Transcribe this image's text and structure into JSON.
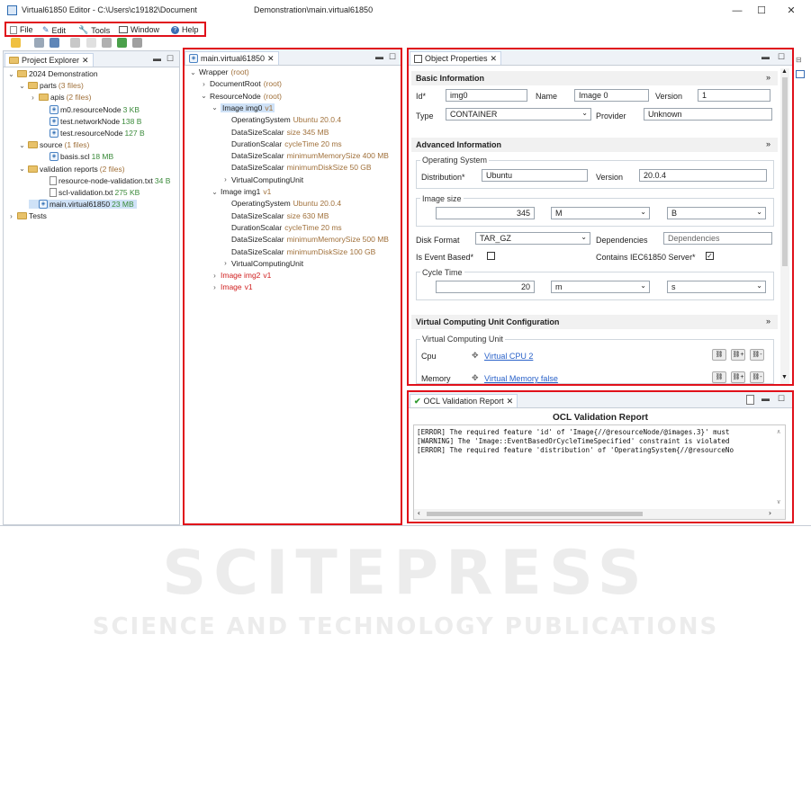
{
  "window": {
    "title": "Virtual61850 Editor - C:\\Users\\c19182\\Document",
    "title_suffix": "Demonstration\\main.virtual61850",
    "controls": [
      "—",
      "☐",
      "✕"
    ]
  },
  "menu": [
    "File",
    "Edit",
    "Tools",
    "Window",
    "Help"
  ],
  "project_explorer": {
    "tab_label": "Project Explorer",
    "items": [
      {
        "label": "2024 Demonstration",
        "extra": "",
        "depth": 0,
        "arrow": "⌄",
        "icon": "project"
      },
      {
        "label": "parts",
        "extra": "(3 files)",
        "depth": 1,
        "arrow": "⌄",
        "icon": "folder"
      },
      {
        "label": "apis",
        "extra": "(2 files)",
        "depth": 2,
        "arrow": "›",
        "icon": "folder"
      },
      {
        "label": "m0.resourceNode",
        "extra": "3 KB",
        "depth": 3,
        "arrow": "",
        "icon": "file"
      },
      {
        "label": "test.networkNode",
        "extra": "138 B",
        "depth": 3,
        "arrow": "",
        "icon": "file"
      },
      {
        "label": "test.resourceNode",
        "extra": "127 B",
        "depth": 3,
        "arrow": "",
        "icon": "file"
      },
      {
        "label": "source",
        "extra": "(1 files)",
        "depth": 1,
        "arrow": "⌄",
        "icon": "folder"
      },
      {
        "label": "basis.scl",
        "extra": "18 MB",
        "depth": 3,
        "arrow": "",
        "icon": "file"
      },
      {
        "label": "validation reports",
        "extra": "(2 files)",
        "depth": 1,
        "arrow": "⌄",
        "icon": "folder"
      },
      {
        "label": "resource-node-validation.txt",
        "extra": "34 B",
        "depth": 3,
        "arrow": "",
        "icon": "txt"
      },
      {
        "label": "scl-validation.txt",
        "extra": "275 KB",
        "depth": 3,
        "arrow": "",
        "icon": "txt"
      },
      {
        "label": "main.virtual61850",
        "extra": "23 MB",
        "depth": 2,
        "arrow": "",
        "icon": "file",
        "selected": true
      },
      {
        "label": "Tests",
        "extra": "",
        "depth": 0,
        "arrow": "›",
        "icon": "project"
      }
    ]
  },
  "editor": {
    "tab_label": "main.virtual61850",
    "rows": [
      {
        "label": "Wrapper",
        "extra": "(root)",
        "depth": 0,
        "arrow": "⌄",
        "color": "normal"
      },
      {
        "label": "DocumentRoot",
        "extra": "(root)",
        "depth": 1,
        "arrow": "›",
        "color": "normal"
      },
      {
        "label": "ResourceNode",
        "extra": "(root)",
        "depth": 1,
        "arrow": "⌄",
        "color": "normal"
      },
      {
        "label": "Image img0",
        "extra": "v1",
        "depth": 2,
        "arrow": "⌄",
        "color": "normal",
        "selected": true
      },
      {
        "label": "OperatingSystem",
        "extra": "Ubuntu 20.0.4",
        "depth": 3,
        "arrow": "",
        "color": "normal"
      },
      {
        "label": "DataSizeScalar",
        "extra": "size 345 MB",
        "depth": 3,
        "arrow": "",
        "color": "normal"
      },
      {
        "label": "DurationScalar",
        "extra": "cycleTime 20 ms",
        "depth": 3,
        "arrow": "",
        "color": "normal"
      },
      {
        "label": "DataSizeScalar",
        "extra": "minimumMemorySize 400 MB",
        "depth": 3,
        "arrow": "",
        "color": "normal"
      },
      {
        "label": "DataSizeScalar",
        "extra": "minimumDiskSize 50 GB",
        "depth": 3,
        "arrow": "",
        "color": "normal"
      },
      {
        "label": "VirtualComputingUnit",
        "extra": "",
        "depth": 3,
        "arrow": "›",
        "color": "normal"
      },
      {
        "label": "Image img1",
        "extra": "v1",
        "depth": 2,
        "arrow": "⌄",
        "color": "normal"
      },
      {
        "label": "OperatingSystem",
        "extra": "Ubuntu 20.0.4",
        "depth": 3,
        "arrow": "",
        "color": "normal"
      },
      {
        "label": "DataSizeScalar",
        "extra": "size 630 MB",
        "depth": 3,
        "arrow": "",
        "color": "normal"
      },
      {
        "label": "DurationScalar",
        "extra": "cycleTime 20 ms",
        "depth": 3,
        "arrow": "",
        "color": "normal"
      },
      {
        "label": "DataSizeScalar",
        "extra": "minimumMemorySize 500 MB",
        "depth": 3,
        "arrow": "",
        "color": "normal"
      },
      {
        "label": "DataSizeScalar",
        "extra": "minimumDiskSize 100 GB",
        "depth": 3,
        "arrow": "",
        "color": "normal"
      },
      {
        "label": "VirtualComputingUnit",
        "extra": "",
        "depth": 3,
        "arrow": "›",
        "color": "normal"
      },
      {
        "label": "Image img2",
        "extra": "v1",
        "depth": 2,
        "arrow": "›",
        "color": "red"
      },
      {
        "label": "Image",
        "extra": "v1",
        "depth": 2,
        "arrow": "›",
        "color": "red"
      }
    ]
  },
  "properties": {
    "tab_label": "Object Properties",
    "basic": {
      "header": "Basic Information",
      "id_label": "Id*",
      "id_value": "img0",
      "name_label": "Name",
      "name_value": "Image 0",
      "version_label": "Version",
      "version_value": "1",
      "type_label": "Type",
      "type_value": "CONTAINER",
      "provider_label": "Provider",
      "provider_value": "Unknown"
    },
    "advanced": {
      "header": "Advanced Information",
      "os_group": "Operating System",
      "distribution_label": "Distribution*",
      "distribution_value": "Ubuntu",
      "os_version_label": "Version",
      "os_version_value": "20.0.4",
      "image_size_group": "Image size",
      "image_size_value": "345",
      "image_size_unit1": "M",
      "image_size_unit2": "B",
      "disk_format_label": "Disk Format",
      "disk_format_value": "TAR_GZ",
      "dependencies_label": "Dependencies",
      "dependencies_placeholder": "Dependencies",
      "event_based_label": "Is Event Based*",
      "contains_label": "Contains IEC61850 Server*",
      "cycle_time_group": "Cycle Time",
      "cycle_time_value": "20",
      "cycle_time_unit1": "m",
      "cycle_time_unit2": "s"
    },
    "vcu": {
      "header": "Virtual Computing Unit Configuration",
      "group": "Virtual Computing Unit",
      "cpu_label": "Cpu",
      "cpu_link": "Virtual CPU 2",
      "memory_label": "Memory",
      "memory_link": "Virtual Memory false"
    }
  },
  "ocl": {
    "tab_label": "OCL Validation Report",
    "title": "OCL Validation Report",
    "lines": [
      "[ERROR] The required feature 'id' of 'Image{//@resourceNode/@images.3}' must",
      "[WARNING] The 'Image::EventBasedOrCycleTimeSpecified' constraint is violated",
      "[ERROR] The required feature 'distribution' of 'OperatingSystem{//@resourceNo"
    ]
  },
  "watermark": {
    "big": "SCITEPRESS",
    "small": "SCIENCE AND TECHNOLOGY PUBLICATIONS"
  }
}
